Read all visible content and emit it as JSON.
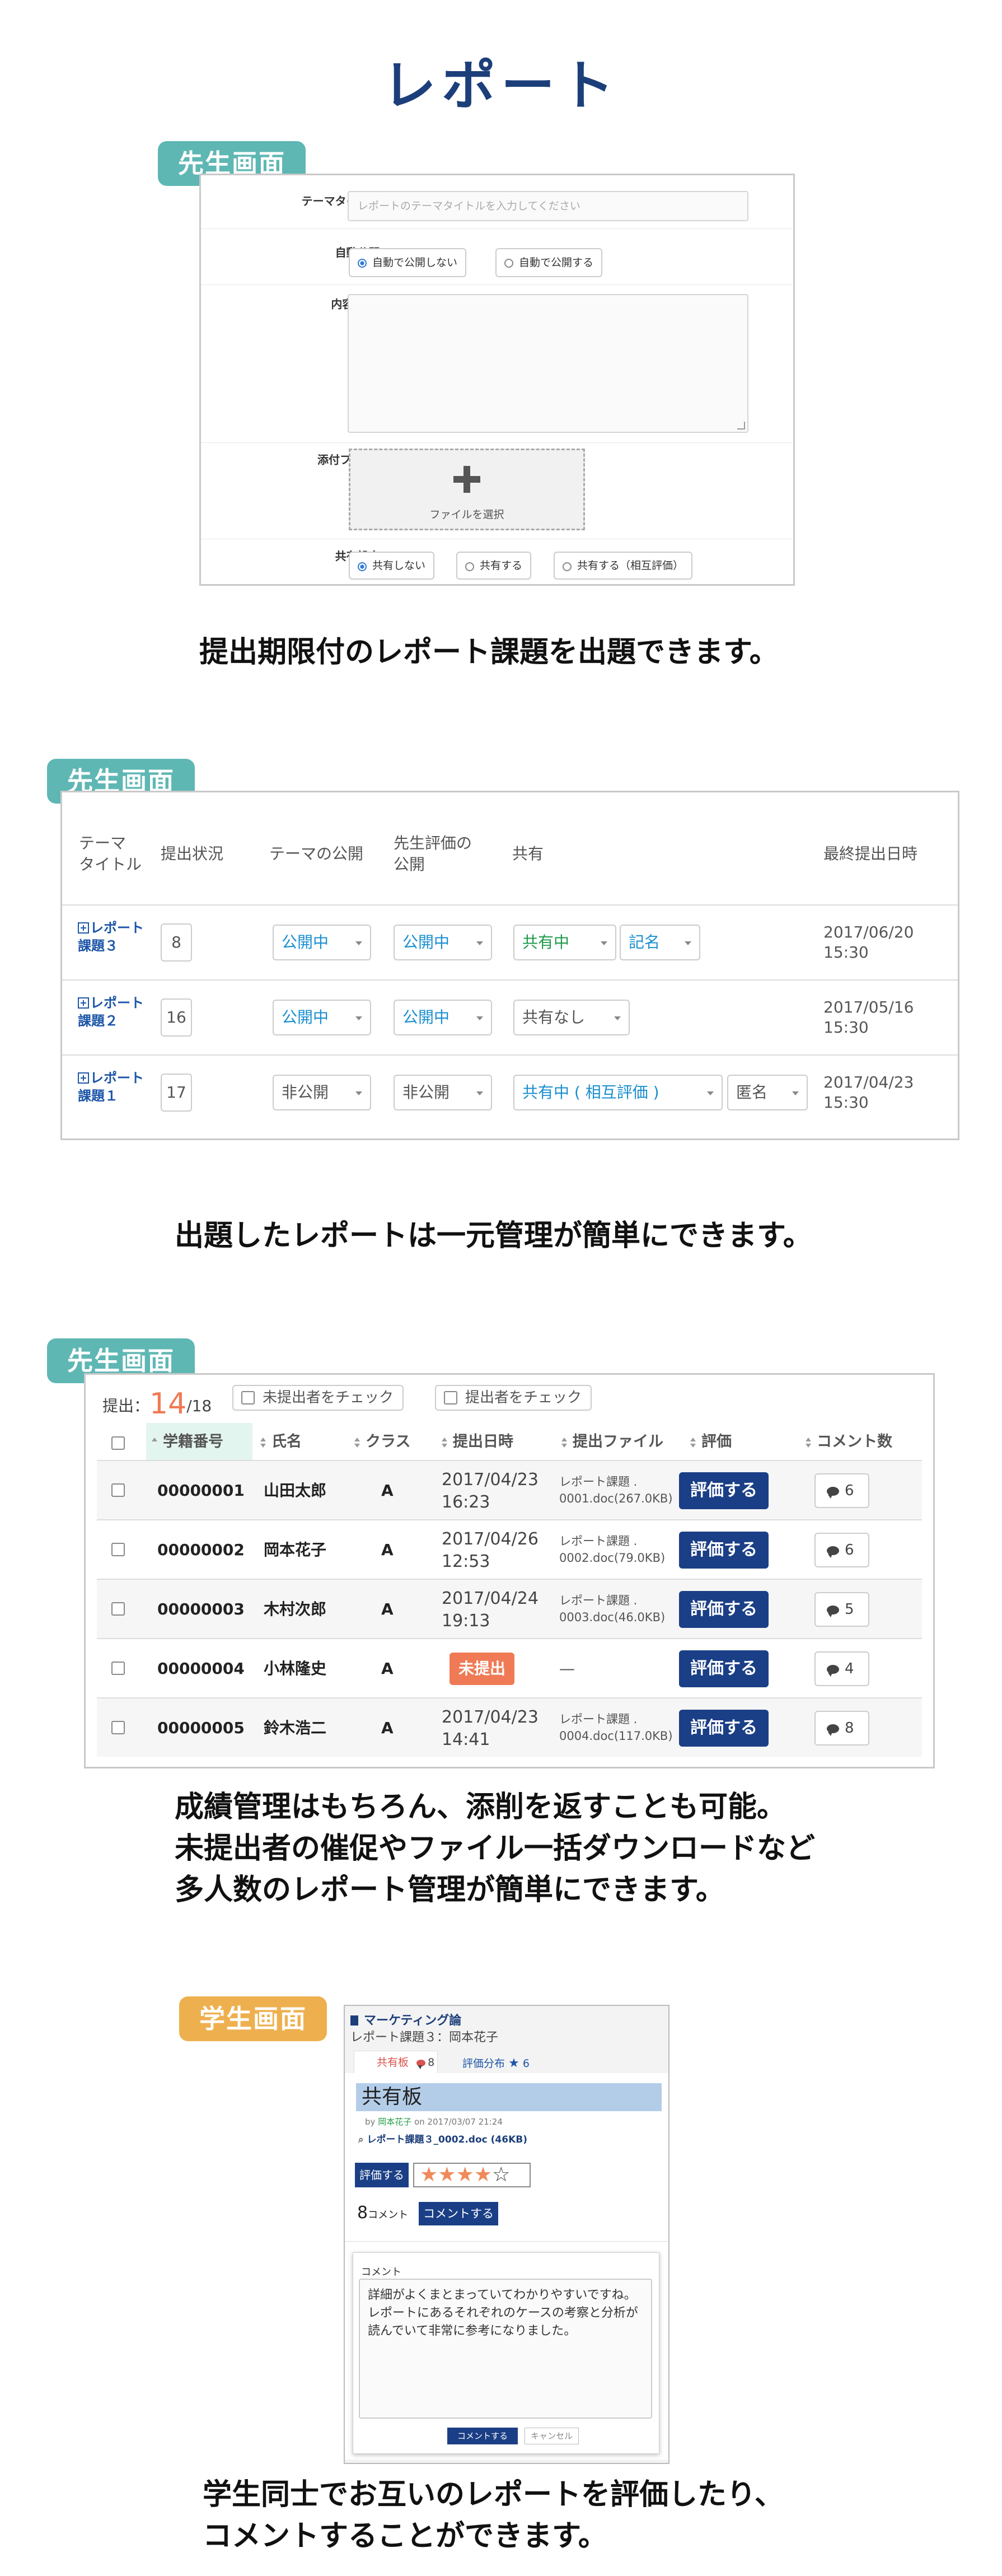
{
  "page_title": "レポート",
  "section1": {
    "tab": "先生画面",
    "form": {
      "theme_label": "テーマタイトル",
      "theme_placeholder": "レポートのテーマタイトルを入力してください",
      "auto_publish_label": "自動公開",
      "auto_publish_options": [
        "自動で公開しない",
        "自動で公開する"
      ],
      "content_label": "内容/備考",
      "attach_label": "添付ファイル",
      "file_select": "ファイルを選択",
      "share_label": "共有設定",
      "share_options": [
        "共有しない",
        "共有する",
        "共有する（相互評価）"
      ],
      "required_mark": "*"
    },
    "caption": "提出期限付のレポート課題を出題できます。"
  },
  "section2": {
    "tab": "先生画面",
    "headers": {
      "theme_title": "テーマ\nタイトル",
      "status": "提出状況",
      "theme_public": "テーマの公開",
      "teacher_eval_public": "先生評価の\n公開",
      "share": "共有",
      "last_submit": "最終提出日時"
    },
    "rows": [
      {
        "title": "レポート\n課題３",
        "count": "8",
        "theme_public": "公開中",
        "eval_public": "公開中",
        "share": "共有中",
        "name_mode": "記名",
        "date": "2017/06/20\n15:30"
      },
      {
        "title": "レポート\n課題２",
        "count": "16",
        "theme_public": "公開中",
        "eval_public": "公開中",
        "share": "共有なし",
        "name_mode": "",
        "date": "2017/05/16\n15:30"
      },
      {
        "title": "レポート\n課題１",
        "count": "17",
        "theme_public": "非公開",
        "eval_public": "非公開",
        "share": "共有中 ( 相互評価 )",
        "name_mode": "匿名",
        "date": "2017/04/23\n15:30"
      }
    ],
    "caption": "出題したレポートは一元管理が簡単にできます。"
  },
  "section3": {
    "tab": "先生画面",
    "submitted_label": "提出：",
    "submitted_count": "14",
    "submitted_total": "/18",
    "check_unsubmitted": "未提出者をチェック",
    "check_submitted": "提出者をチェック",
    "headers": {
      "student_no": "学籍番号",
      "name": "氏名",
      "class": "クラス",
      "submit_date": "提出日時",
      "submit_file": "提出ファイル",
      "eval": "評価",
      "comments": "コメント数"
    },
    "eval_button": "評価する",
    "rows": [
      {
        "no": "00000001",
        "name": "山田太郎",
        "class": "A",
        "date": "2017/04/23\n16:23",
        "file": "レポート課題 .\n0001.doc(267.0KB)",
        "comments": "6"
      },
      {
        "no": "00000002",
        "name": "岡本花子",
        "class": "A",
        "date": "2017/04/26\n12:53",
        "file": "レポート課題 .\n0002.doc(79.0KB)",
        "comments": "6"
      },
      {
        "no": "00000003",
        "name": "木村次郎",
        "class": "A",
        "date": "2017/04/24\n19:13",
        "file": "レポート課題 .\n0003.doc(46.0KB)",
        "comments": "5"
      },
      {
        "no": "00000004",
        "name": "小林隆史",
        "class": "A",
        "date": "未提出",
        "file": "—",
        "comments": "4"
      },
      {
        "no": "00000005",
        "name": "鈴木浩二",
        "class": "A",
        "date": "2017/04/23\n14:41",
        "file": "レポート課題 .\n0004.doc(117.0KB)",
        "comments": "8"
      }
    ],
    "caption": "成績管理はもちろん、添削を返すことも可能。\n未提出者の催促やファイル一括ダウンロードなど\n多人数のレポート管理が簡単にできます。"
  },
  "section4": {
    "tab": "学生画面",
    "course": "マーケティング論",
    "breadcrumb": "レポート課題３：岡本花子",
    "tab_board": "共有板",
    "tab_board_count": "8",
    "tab_dist": "評価分布",
    "tab_dist_count": "6",
    "board_title": "共有板",
    "byline_by": "by",
    "byline_name": "岡本花子",
    "byline_on": "on 2017/03/07 21:24",
    "file_link": "レポート課題３_0002.doc (46KB)",
    "rate_button": "評価する",
    "rating": 4,
    "rating_max": 5,
    "comment_count": "8",
    "comment_unit": "コメント",
    "comment_button": "コメントする",
    "comment_label": "コメント",
    "comment_text": "詳細がよくまとまっていてわかりやすいですね。レポートにあるそれぞれのケースの考察と分析が読んでいて非常に参考になりました。",
    "submit_button": "コメントする",
    "cancel_button": "キャンセル",
    "caption": "学生同士でお互いのレポートを評価したり、\nコメントすることができます。"
  }
}
